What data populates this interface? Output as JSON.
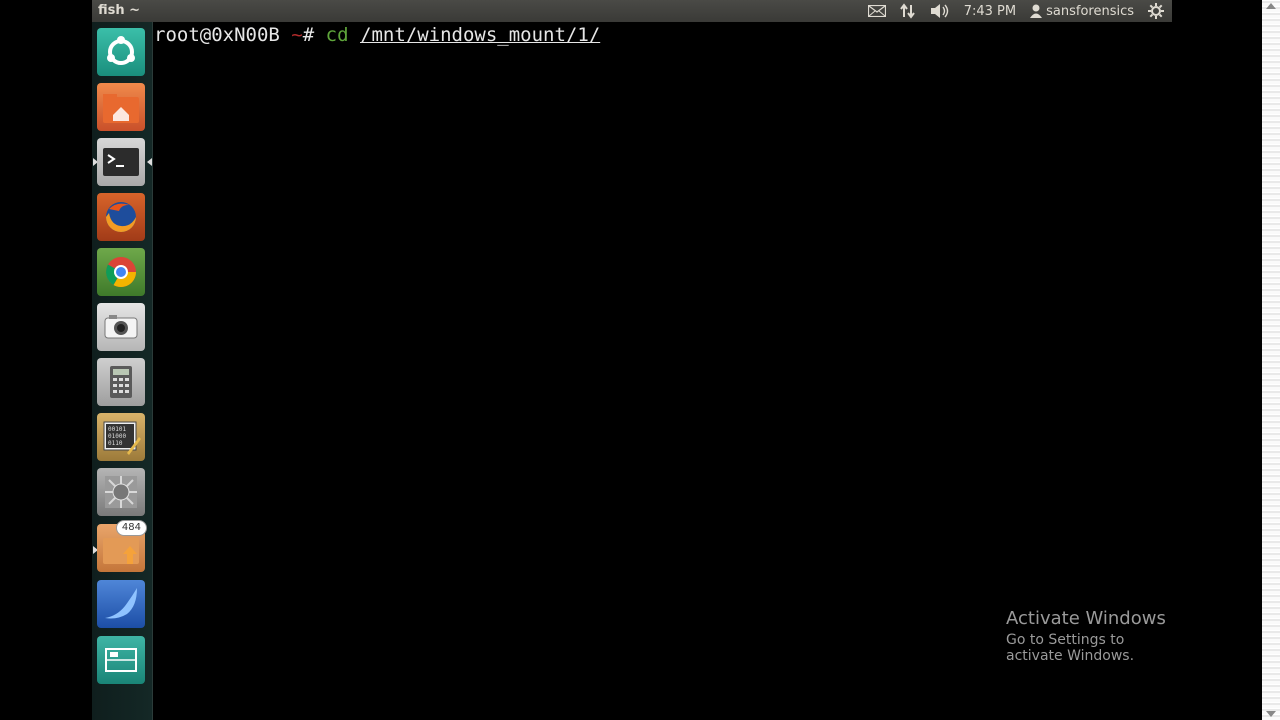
{
  "panel": {
    "title": "fish ~",
    "clock": "7:43 PM",
    "user": "sansforensics"
  },
  "launcher": {
    "items": [
      {
        "name": "ubuntu-home-icon"
      },
      {
        "name": "files-home-folder-icon"
      },
      {
        "name": "terminal-icon"
      },
      {
        "name": "firefox-icon"
      },
      {
        "name": "chrome-icon"
      },
      {
        "name": "camera-icon"
      },
      {
        "name": "calculator-icon"
      },
      {
        "name": "hex-editor-icon"
      },
      {
        "name": "forensics-tool-icon"
      },
      {
        "name": "update-folder-icon",
        "badge": "484"
      },
      {
        "name": "wireshark-icon"
      },
      {
        "name": "workspace-switcher-icon"
      }
    ]
  },
  "terminal": {
    "host": "root@0xN00B",
    "tilde": "~",
    "hash": "#",
    "command": "cd",
    "path": "/mnt/windows_mount/1/"
  },
  "watermark": {
    "title": "Activate Windows",
    "subtitle": "Go to Settings to activate Windows."
  }
}
